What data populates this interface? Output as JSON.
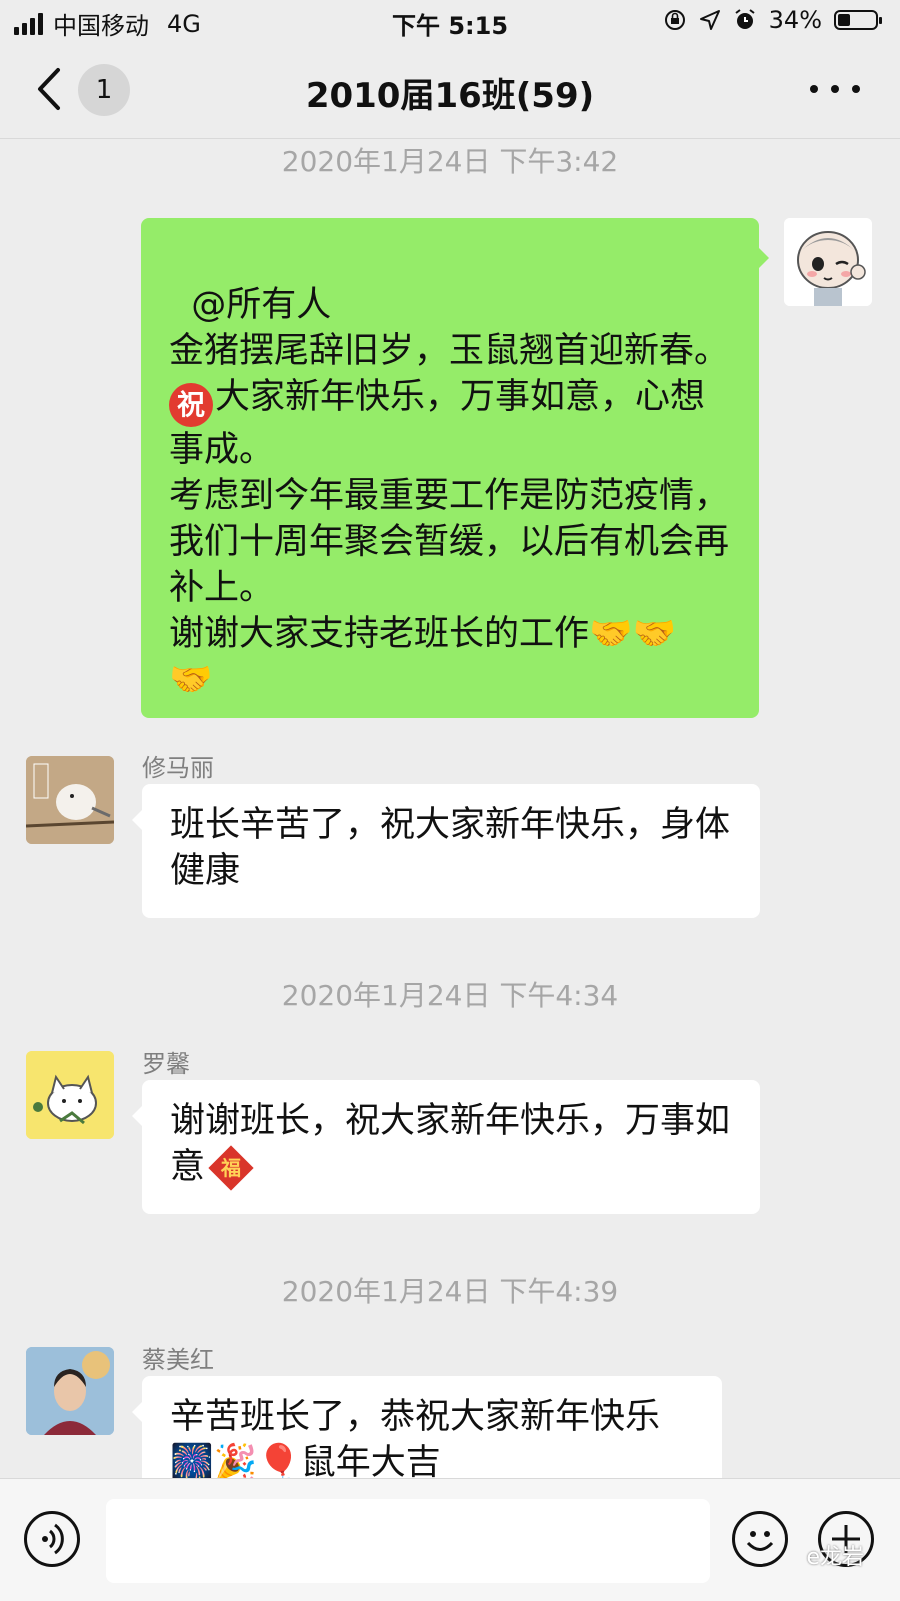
{
  "status_bar": {
    "carrier": "中国移动",
    "network": "4G",
    "time": "下午 5:15",
    "battery": "34%",
    "battery_level": 0.34
  },
  "nav": {
    "unread_count": "1",
    "title": "2010届16班(59)"
  },
  "messages": [
    {
      "type": "timestamp",
      "text": "2020年1月24日 下午3:42"
    },
    {
      "type": "outgoing",
      "text": "@所有人\n金猪摆尾辞旧岁，玉鼠翘首迎新春。\n大家新年快乐，万事如意，心想事成。\n考虑到今年最重要工作是防范疫情，我们十周年聚会暂缓，以后有机会再补上。\n谢谢大家支持老班长的工作🤝🤝🤝",
      "emoji_badge": "祝"
    },
    {
      "type": "incoming",
      "sender": "修马丽",
      "text": "班长辛苦了，祝大家新年快乐，身体健康"
    },
    {
      "type": "timestamp",
      "text": "2020年1月24日 下午4:34"
    },
    {
      "type": "incoming",
      "sender": "罗馨",
      "text": "谢谢班长，祝大家新年快乐，万事如意",
      "fu_badge": "福"
    },
    {
      "type": "timestamp",
      "text": "2020年1月24日 下午4:39"
    },
    {
      "type": "incoming",
      "sender": "蔡美红",
      "text": "辛苦班长了，恭祝大家新年快乐🎆🎉🎈鼠年大吉"
    }
  ],
  "input_bar": {
    "placeholder": "",
    "watermark": "e龙岩"
  },
  "icons": {
    "back": "chevron-left-icon",
    "more": "more-dots-icon",
    "voice": "voice-icon",
    "emoji": "emoji-icon",
    "plus": "plus-icon"
  },
  "colors": {
    "outgoing_bubble": "#95ec69",
    "incoming_bubble": "#ffffff",
    "background": "#ededed"
  }
}
